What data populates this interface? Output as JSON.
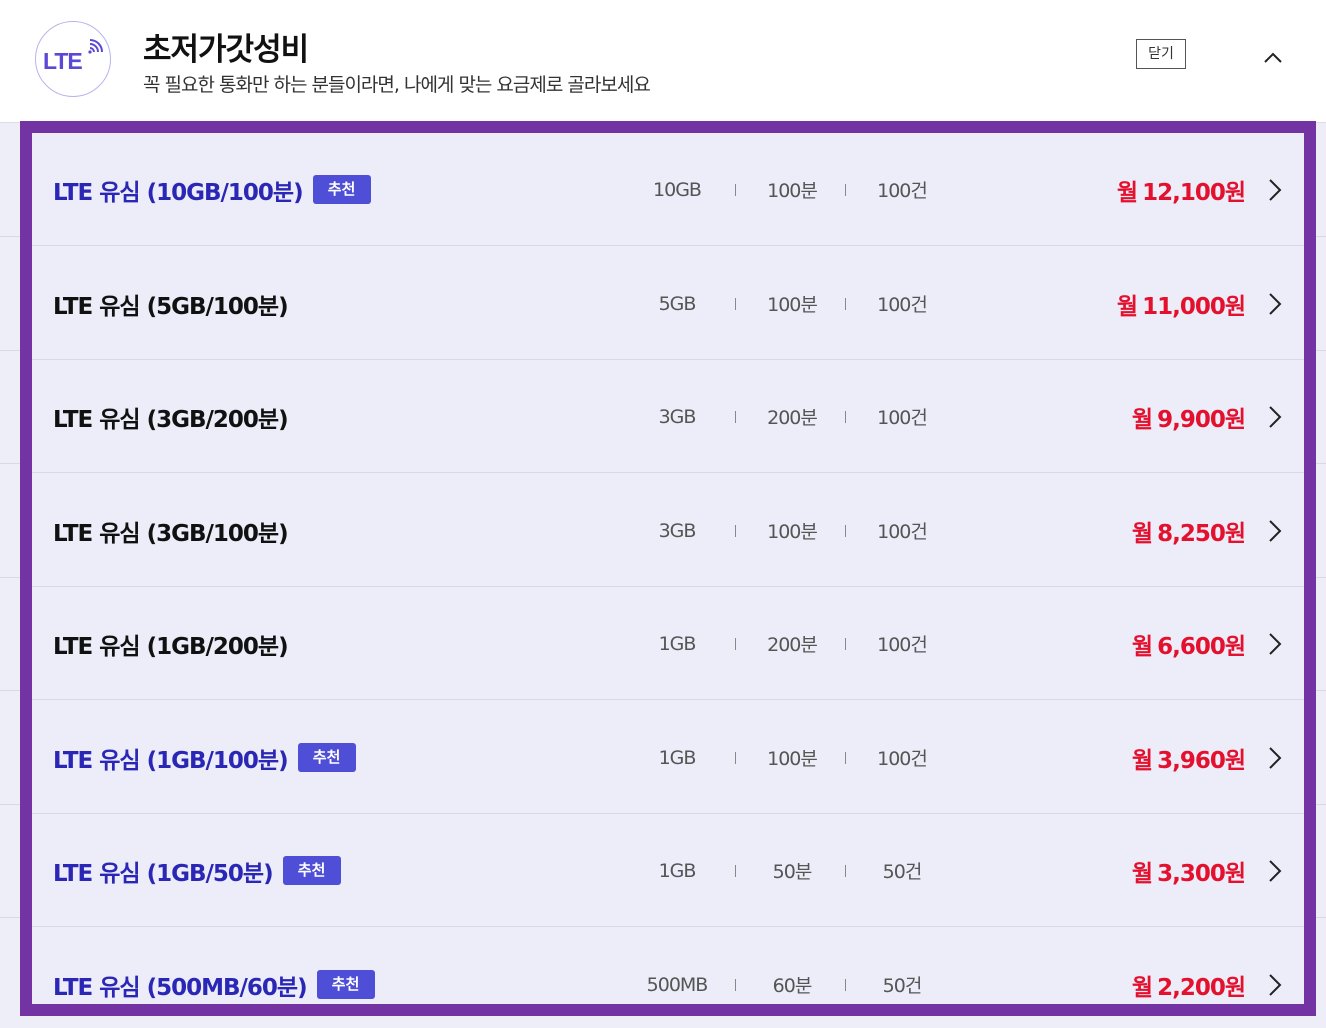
{
  "header": {
    "badge_text": "LTE",
    "title": "초저가갓성비",
    "subtitle": "꼭 필요한 통화만 하는 분들이라면, 나에게 맞는 요금제로 골라보세요",
    "close_label": "닫기"
  },
  "plans": [
    {
      "name": "LTE 유심 (10GB/100분)",
      "badge": "추천",
      "data": "10GB",
      "voice": "100분",
      "sms": "100건",
      "price_prefix": "월",
      "price": "12,100원"
    },
    {
      "name": "LTE 유심 (5GB/100분)",
      "badge": "",
      "data": "5GB",
      "voice": "100분",
      "sms": "100건",
      "price_prefix": "월",
      "price": "11,000원"
    },
    {
      "name": "LTE 유심 (3GB/200분)",
      "badge": "",
      "data": "3GB",
      "voice": "200분",
      "sms": "100건",
      "price_prefix": "월",
      "price": "9,900원"
    },
    {
      "name": "LTE 유심 (3GB/100분)",
      "badge": "",
      "data": "3GB",
      "voice": "100분",
      "sms": "100건",
      "price_prefix": "월",
      "price": "8,250원"
    },
    {
      "name": "LTE 유심 (1GB/200분)",
      "badge": "",
      "data": "1GB",
      "voice": "200분",
      "sms": "100건",
      "price_prefix": "월",
      "price": "6,600원"
    },
    {
      "name": "LTE 유심 (1GB/100분)",
      "badge": "추천",
      "data": "1GB",
      "voice": "100분",
      "sms": "100건",
      "price_prefix": "월",
      "price": "3,960원"
    },
    {
      "name": "LTE 유심 (1GB/50분)",
      "badge": "추천",
      "data": "1GB",
      "voice": "50분",
      "sms": "50건",
      "price_prefix": "월",
      "price": "3,300원"
    },
    {
      "name": "LTE 유심 (500MB/60분)",
      "badge": "추천",
      "data": "500MB",
      "voice": "60분",
      "sms": "50건",
      "price_prefix": "월",
      "price": "2,200원"
    }
  ],
  "colors": {
    "frame": "#7333a2",
    "recommended_name": "#2a27b5",
    "badge_bg": "#4f4ed6",
    "price": "#e3112d",
    "row_bg": "#ededf9"
  },
  "icons": {
    "header_badge": "lte-signal-icon",
    "collapse": "chevron-up-icon",
    "row_arrow": "chevron-right-icon"
  }
}
